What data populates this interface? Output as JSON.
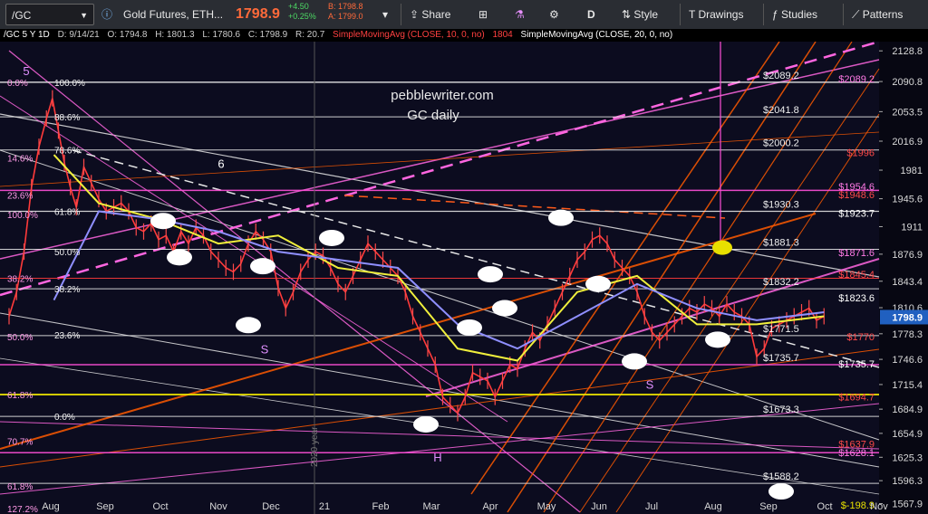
{
  "toolbar": {
    "symbol": "/GC",
    "description": "Gold Futures, ETH...",
    "last": "1798.9",
    "change": "+4.50",
    "change_pct": "+0.25%",
    "bid": "B: 1798.8",
    "ask": "A: 1799.0",
    "share_label": "Share",
    "period_label": "D",
    "style_label": "Style",
    "drawings_label": "Drawings",
    "studies_label": "Studies",
    "patterns_label": "Patterns"
  },
  "infobar": {
    "symbol_period": "/GC 5 Y 1D",
    "date": "D: 9/14/21",
    "open": "O: 1794.8",
    "high": "H: 1801.3",
    "low": "L: 1780.6",
    "close": "C: 1798.9",
    "range": "R: 20.7",
    "sma10": "SimpleMovingAvg (CLOSE, 10, 0, no)",
    "sma10_value": "1804",
    "sma20": "SimpleMovingAvg (CLOSE, 20, 0, no)"
  },
  "colors": {
    "background": "#0c0c1f",
    "fib_white": "#e6e6e6",
    "fib_pink": "#ff4fd8",
    "fib_yellow": "#e8e000",
    "red_label": "#ff3a3a",
    "sma10": "#ff5a1a",
    "sma20": "#f0ef3c",
    "channel_orange": "#ff5a00",
    "channel_magenta": "#ff66e0",
    "price_tag": "#2060c0"
  },
  "chart_data": {
    "type": "line",
    "title": "pebblewriter.com",
    "subtitle": "GC daily",
    "watermark": "2020 year",
    "xlabel": "",
    "ylabel": "",
    "ylim": [
      1555,
      2138
    ],
    "grid": false,
    "last_price": "1798.9",
    "x_ticks": [
      "Aug",
      "Sep",
      "Oct",
      "Nov",
      "Dec",
      "21",
      "Feb",
      "Mar",
      "Apr",
      "May",
      "Jun",
      "Jul",
      "Aug",
      "Sep",
      "Oct",
      "Nov"
    ],
    "y_ticks": [
      "2128.8",
      "2090.8",
      "2053.5",
      "2016.9",
      "1981",
      "1945.6",
      "1911",
      "1876.9",
      "1843.4",
      "1810.6",
      "1778.3",
      "1746.6",
      "1715.4",
      "1684.9",
      "1654.9",
      "1625.3",
      "1596.3",
      "1567.9"
    ],
    "price_path": [
      [
        0,
        1800
      ],
      [
        5,
        1830
      ],
      [
        10,
        1880
      ],
      [
        15,
        1960
      ],
      [
        20,
        2010
      ],
      [
        25,
        2045
      ],
      [
        29,
        2070
      ],
      [
        33,
        2030
      ],
      [
        37,
        1990
      ],
      [
        41,
        1960
      ],
      [
        45,
        1935
      ],
      [
        50,
        1985
      ],
      [
        55,
        1965
      ],
      [
        60,
        1945
      ],
      [
        65,
        1930
      ],
      [
        70,
        1935
      ],
      [
        75,
        1940
      ],
      [
        80,
        1930
      ],
      [
        85,
        1910
      ],
      [
        90,
        1905
      ],
      [
        95,
        1915
      ],
      [
        100,
        1895
      ],
      [
        105,
        1900
      ],
      [
        110,
        1880
      ],
      [
        115,
        1905
      ],
      [
        120,
        1890
      ],
      [
        125,
        1910
      ],
      [
        130,
        1900
      ],
      [
        135,
        1880
      ],
      [
        140,
        1870
      ],
      [
        145,
        1860
      ],
      [
        150,
        1855
      ],
      [
        155,
        1865
      ],
      [
        160,
        1890
      ],
      [
        165,
        1905
      ],
      [
        170,
        1895
      ],
      [
        175,
        1880
      ],
      [
        180,
        1835
      ],
      [
        185,
        1810
      ],
      [
        190,
        1830
      ],
      [
        195,
        1855
      ],
      [
        200,
        1870
      ],
      [
        205,
        1880
      ],
      [
        210,
        1875
      ],
      [
        215,
        1860
      ],
      [
        220,
        1840
      ],
      [
        225,
        1830
      ],
      [
        230,
        1850
      ],
      [
        235,
        1870
      ],
      [
        240,
        1890
      ],
      [
        245,
        1880
      ],
      [
        250,
        1870
      ],
      [
        255,
        1860
      ],
      [
        260,
        1850
      ],
      [
        265,
        1830
      ],
      [
        270,
        1800
      ],
      [
        275,
        1780
      ],
      [
        280,
        1760
      ],
      [
        285,
        1740
      ],
      [
        290,
        1700
      ],
      [
        295,
        1690
      ],
      [
        300,
        1680
      ],
      [
        305,
        1700
      ],
      [
        310,
        1730
      ],
      [
        315,
        1725
      ],
      [
        320,
        1720
      ],
      [
        325,
        1700
      ],
      [
        330,
        1720
      ],
      [
        335,
        1740
      ],
      [
        340,
        1735
      ],
      [
        345,
        1760
      ],
      [
        350,
        1780
      ],
      [
        355,
        1770
      ],
      [
        360,
        1790
      ],
      [
        365,
        1810
      ],
      [
        370,
        1830
      ],
      [
        375,
        1850
      ],
      [
        380,
        1870
      ],
      [
        385,
        1880
      ],
      [
        390,
        1895
      ],
      [
        395,
        1900
      ],
      [
        400,
        1890
      ],
      [
        405,
        1870
      ],
      [
        410,
        1860
      ],
      [
        415,
        1850
      ],
      [
        420,
        1830
      ],
      [
        425,
        1800
      ],
      [
        430,
        1780
      ],
      [
        435,
        1770
      ],
      [
        440,
        1780
      ],
      [
        445,
        1790
      ],
      [
        450,
        1800
      ],
      [
        455,
        1810
      ],
      [
        460,
        1805
      ],
      [
        465,
        1815
      ],
      [
        470,
        1810
      ],
      [
        475,
        1800
      ],
      [
        480,
        1815
      ],
      [
        485,
        1805
      ],
      [
        490,
        1800
      ],
      [
        495,
        1790
      ],
      [
        500,
        1750
      ],
      [
        505,
        1760
      ],
      [
        510,
        1785
      ],
      [
        515,
        1790
      ],
      [
        520,
        1795
      ],
      [
        525,
        1800
      ],
      [
        530,
        1805
      ],
      [
        535,
        1810
      ],
      [
        540,
        1795
      ],
      [
        545,
        1800
      ]
    ],
    "series": [
      {
        "values": [
          [
            30,
            2000
          ],
          [
            60,
            1940
          ],
          [
            100,
            1920
          ],
          [
            140,
            1890
          ],
          [
            180,
            1900
          ],
          [
            220,
            1860
          ],
          [
            260,
            1850
          ],
          [
            300,
            1760
          ],
          [
            340,
            1745
          ],
          [
            380,
            1830
          ],
          [
            420,
            1850
          ],
          [
            460,
            1790
          ],
          [
            500,
            1790
          ],
          [
            545,
            1800
          ]
        ]
      },
      {
        "values": [
          [
            30,
            1820
          ],
          [
            60,
            1930
          ],
          [
            100,
            1920
          ],
          [
            140,
            1905
          ],
          [
            180,
            1880
          ],
          [
            220,
            1870
          ],
          [
            260,
            1860
          ],
          [
            300,
            1790
          ],
          [
            340,
            1760
          ],
          [
            380,
            1800
          ],
          [
            420,
            1840
          ],
          [
            460,
            1810
          ],
          [
            500,
            1795
          ],
          [
            545,
            1805
          ]
        ]
      }
    ],
    "fib_levels_left": [
      {
        "label": "0.0%",
        "price": 2090
      },
      {
        "label": "14.6%",
        "price": 1996
      },
      {
        "label": "23.6%",
        "price": 1950
      },
      {
        "label": "100.0%",
        "price": 1926
      },
      {
        "label": "38.2%",
        "price": 1847
      },
      {
        "label": "50.0%",
        "price": 1775
      },
      {
        "label": "61.8%",
        "price": 1703
      },
      {
        "label": "70.7%",
        "price": 1645
      },
      {
        "label": "61.8%",
        "price": 1590
      },
      {
        "label": "127.2%",
        "price": 1562
      }
    ],
    "fib_levels_mid": [
      {
        "label": "100.0%",
        "price": 2090
      },
      {
        "label": "88.6%",
        "price": 2047
      },
      {
        "label": "78.6%",
        "price": 2006
      },
      {
        "label": "61.8%",
        "price": 1930
      },
      {
        "label": "50.0%",
        "price": 1880
      },
      {
        "label": "38.2%",
        "price": 1834
      },
      {
        "label": "23.6%",
        "price": 1777
      },
      {
        "label": "0.0%",
        "price": 1676
      }
    ],
    "level_lines": [
      {
        "label": "$2089.2",
        "price": 2090
      },
      {
        "label": "$2041.8",
        "price": 2047
      },
      {
        "label": "$2000.2",
        "price": 2006
      },
      {
        "label": "$1930.3",
        "price": 1930
      },
      {
        "label": "$1881.3",
        "price": 1883
      },
      {
        "label": "$1832.2",
        "price": 1834
      },
      {
        "label": "$1771.5",
        "price": 1776
      },
      {
        "label": "$1735.7",
        "price": 1740
      },
      {
        "label": "$1673.3",
        "price": 1676
      },
      {
        "label": "$1588.2",
        "price": 1593
      }
    ],
    "right_labels": [
      {
        "text": "$2089.2",
        "price": 2094,
        "color": "pink"
      },
      {
        "text": "$1996",
        "price": 2003,
        "color": "red"
      },
      {
        "text": "$1954.6",
        "price": 1961,
        "color": "pink"
      },
      {
        "text": "$1948.6",
        "price": 1951,
        "color": "red"
      },
      {
        "text": "$1923.7",
        "price": 1928,
        "color": "white"
      },
      {
        "text": "$1871.6",
        "price": 1879,
        "color": "pink"
      },
      {
        "text": "$1845.4",
        "price": 1852,
        "color": "red"
      },
      {
        "text": "$1823.6",
        "price": 1823,
        "color": "white"
      },
      {
        "text": "$1770",
        "price": 1775,
        "color": "red"
      },
      {
        "text": "$1735.7",
        "price": 1741,
        "color": "white"
      },
      {
        "text": "$1694.7",
        "price": 1700,
        "color": "red"
      },
      {
        "text": "$1637.9",
        "price": 1642,
        "color": "red"
      },
      {
        "text": "$1628.1",
        "price": 1631,
        "color": "pink"
      },
      {
        "text": "$-198.9",
        "price": 1566,
        "color": "yellow"
      }
    ],
    "annotations": [
      {
        "text": "5",
        "x": 29,
        "price": 2099
      },
      {
        "text": "6",
        "x": 244,
        "price": 1984
      },
      {
        "text": "S",
        "x": 292,
        "price": 1754
      },
      {
        "text": "H",
        "x": 483,
        "price": 1620
      },
      {
        "text": "S",
        "x": 717,
        "price": 1710
      }
    ],
    "markers": [
      {
        "x": 180,
        "price": 1918
      },
      {
        "x": 198,
        "price": 1873
      },
      {
        "x": 290,
        "price": 1862
      },
      {
        "x": 274,
        "price": 1789
      },
      {
        "x": 366,
        "price": 1897
      },
      {
        "x": 541,
        "price": 1852
      },
      {
        "x": 557,
        "price": 1810
      },
      {
        "x": 518,
        "price": 1786
      },
      {
        "x": 619,
        "price": 1922
      },
      {
        "x": 660,
        "price": 1840
      },
      {
        "x": 700,
        "price": 1744
      },
      {
        "x": 792,
        "price": 1771
      },
      {
        "x": 470,
        "price": 1666
      },
      {
        "x": 862,
        "price": 1583
      }
    ],
    "yellow_marker": {
      "x": 797,
      "price": 1885
    }
  }
}
